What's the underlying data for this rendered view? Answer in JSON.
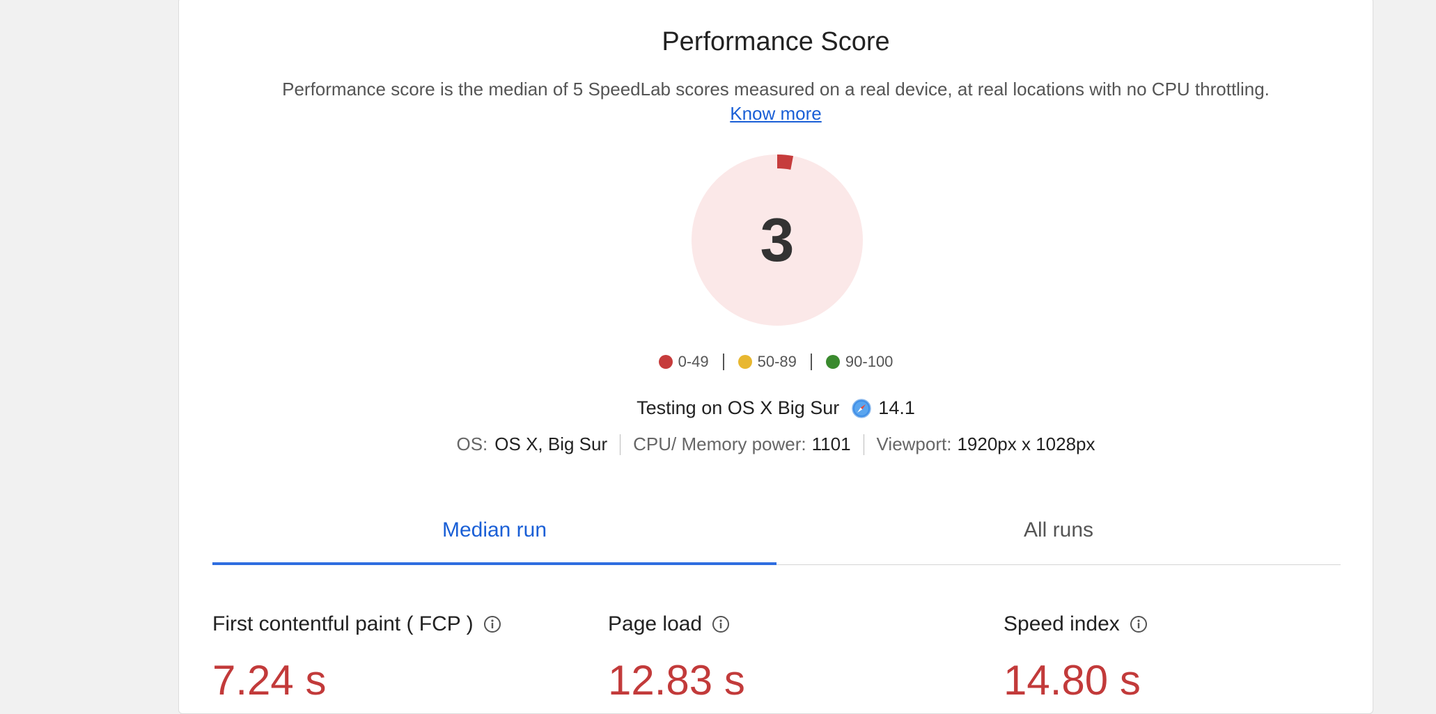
{
  "header": {
    "title": "Performance Score",
    "description": "Performance score is the median of 5 SpeedLab scores measured on a real device, at real locations with no CPU throttling.",
    "know_more": "Know more"
  },
  "score": {
    "value": "3",
    "fraction": 0.03,
    "color": "#c63c3c",
    "track_color": "#fbe8e8"
  },
  "legend": [
    {
      "label": "0-49",
      "color": "#c63c3c"
    },
    {
      "label": "50-89",
      "color": "#e8b730"
    },
    {
      "label": "90-100",
      "color": "#3a8a2e"
    }
  ],
  "testing": {
    "label": "Testing on OS X Big Sur",
    "browser_icon": "safari-icon",
    "browser_version": "14.1"
  },
  "specs": {
    "os_label": "OS:",
    "os_value": "OS X, Big Sur",
    "cpu_label": "CPU/ Memory power:",
    "cpu_value": "1101",
    "viewport_label": "Viewport:",
    "viewport_value": "1920px x 1028px"
  },
  "tabs": [
    {
      "label": "Median run",
      "active": true
    },
    {
      "label": "All runs",
      "active": false
    }
  ],
  "metrics": [
    {
      "label": "First contentful paint ( FCP )",
      "value": "7.24 s",
      "icon": "info-icon"
    },
    {
      "label": "Page load",
      "value": "12.83 s",
      "icon": "info-icon"
    },
    {
      "label": "Speed index",
      "value": "14.80 s",
      "icon": "info-icon"
    }
  ]
}
